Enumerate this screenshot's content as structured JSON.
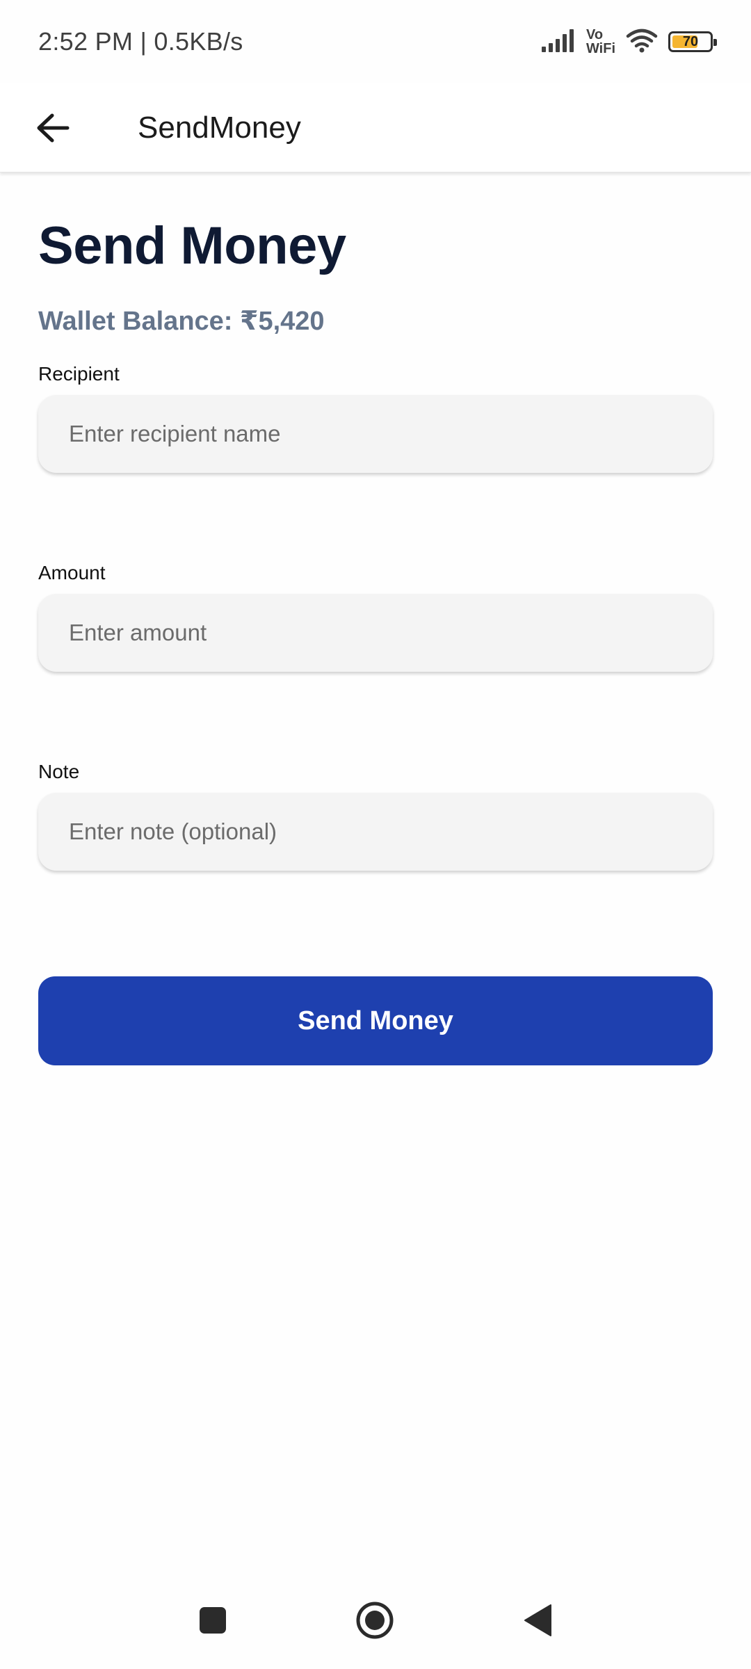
{
  "status_bar": {
    "time_speed": "2:52 PM | 0.5KB/s",
    "vo_top": "Vo",
    "vo_bottom": "WiFi",
    "battery": "70",
    "battery_level": 0.7,
    "battery_color": "#f5b531",
    "icons": [
      "signal-icon",
      "vowifi-icon",
      "wifi-icon",
      "battery-icon"
    ]
  },
  "app_bar": {
    "title": "SendMoney",
    "back_icon": "arrow-left-icon"
  },
  "page": {
    "title": "Send Money",
    "wallet_balance": "Wallet Balance: ₹5,420"
  },
  "form": {
    "recipient": {
      "label": "Recipient",
      "value": "",
      "placeholder": "Enter recipient name"
    },
    "amount": {
      "label": "Amount",
      "value": "",
      "placeholder": "Enter amount"
    },
    "note": {
      "label": "Note",
      "value": "",
      "placeholder": "Enter note (optional)"
    },
    "submit_label": "Send Money"
  },
  "colors": {
    "primary": "#1e40af",
    "title": "#0f1a33",
    "balance": "#64748b",
    "input_bg": "#f4f4f4"
  },
  "nav_bar": {
    "icons": [
      "recents-icon",
      "home-icon",
      "back-icon"
    ]
  }
}
